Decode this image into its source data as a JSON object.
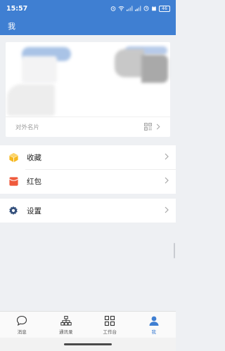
{
  "status_bar": {
    "time": "15:57",
    "battery": "46"
  },
  "header": {
    "title": "我"
  },
  "profile_card": {
    "footer_label": "对外名片"
  },
  "menu": {
    "items": [
      {
        "label": "收藏",
        "icon": "favorites-box-icon",
        "color": "#f6b81f"
      },
      {
        "label": "红包",
        "icon": "red-packet-icon",
        "color": "#ef5a3c"
      }
    ],
    "settings": {
      "label": "设置",
      "icon": "gear-icon",
      "color": "#34507c"
    }
  },
  "tabs": [
    {
      "label": "消息",
      "icon": "chat-bubble-icon",
      "active": false
    },
    {
      "label": "通讯录",
      "icon": "org-chart-icon",
      "active": false
    },
    {
      "label": "工作台",
      "icon": "grid-icon",
      "active": false
    },
    {
      "label": "我",
      "icon": "person-icon",
      "active": true
    }
  ],
  "colors": {
    "brand_blue": "#3f7fd2",
    "background": "#eef0f3"
  }
}
